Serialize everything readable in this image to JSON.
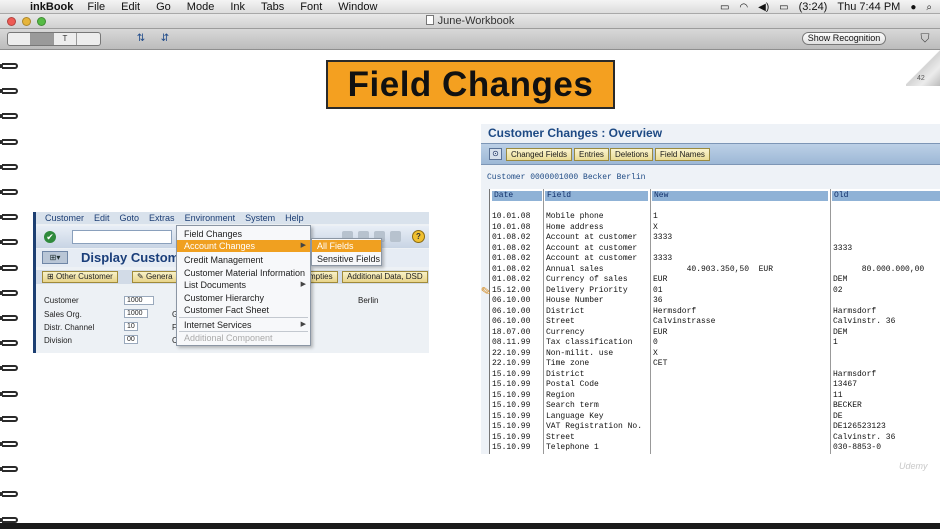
{
  "menubar": {
    "app_name": "inkBook",
    "items": [
      "File",
      "Edit",
      "Go",
      "Mode",
      "Ink",
      "Tabs",
      "Font",
      "Window"
    ],
    "battery": "(3:24)",
    "clock": "Thu 7:44 PM"
  },
  "window": {
    "title": "June-Workbook"
  },
  "toolbar": {
    "tool_labels": [
      "",
      "",
      "T",
      ""
    ],
    "show_recognition": "Show Recognition"
  },
  "page": {
    "page_number": "42",
    "banner": "Field Changes"
  },
  "sap_left": {
    "menu": [
      "Customer",
      "Edit",
      "Goto",
      "Extras",
      "Environment",
      "System",
      "Help"
    ],
    "screen_title": "Display Custom",
    "appbar": [
      "Other Customer",
      "Genera",
      "mpties",
      "Additional Data, DSD"
    ],
    "fields": [
      {
        "label": "Customer",
        "value": "1000",
        "extra": "Berlin"
      },
      {
        "label": "Sales Org.",
        "value": "1000",
        "extra": "G"
      },
      {
        "label": "Distr. Channel",
        "value": "10",
        "extra": "Fi"
      },
      {
        "label": "Division",
        "value": "00",
        "extra": "C"
      }
    ]
  },
  "context_menu": {
    "items": [
      {
        "label": "Field Changes"
      },
      {
        "label": "Account Changes"
      },
      {
        "label": "Credit Management"
      },
      {
        "label": "Customer Material Information"
      },
      {
        "label": "List Documents"
      },
      {
        "label": "Customer Hierarchy"
      },
      {
        "label": "Customer Fact Sheet"
      },
      {
        "label": "Internet Services"
      },
      {
        "label": "Additional Component"
      }
    ],
    "submenu": [
      {
        "label": "All Fields"
      },
      {
        "label": "Sensitive Fields"
      }
    ]
  },
  "sap_right": {
    "title": "Customer Changes : Overview",
    "toolbar_buttons": [
      "Changed Fields",
      "Entries",
      "Deletions",
      "Field Names"
    ],
    "customer_line": "Customer 0000001000 Becker Berlin",
    "columns": [
      "Date",
      "Field",
      "New",
      "Old"
    ],
    "rows": [
      {
        "date": "10.01.08",
        "field": "Mobile phone",
        "new": "1",
        "old": ""
      },
      {
        "date": "10.01.08",
        "field": "Home address",
        "new": "X",
        "old": ""
      },
      {
        "date": "01.08.02",
        "field": "Account at customer",
        "new": "3333",
        "old": ""
      },
      {
        "date": "01.08.02",
        "field": "Account at customer",
        "new": "",
        "old": "3333"
      },
      {
        "date": "01.08.02",
        "field": "Account at customer",
        "new": "3333",
        "old": ""
      },
      {
        "date": "01.08.02",
        "field": "Annual sales",
        "new": "       40.903.350,50  EUR",
        "old": "      80.000.000,00"
      },
      {
        "date": "01.08.02",
        "field": "Currency of sales",
        "new": "EUR",
        "old": "DEM"
      },
      {
        "date": "15.12.00",
        "field": "Delivery Priority",
        "new": "01",
        "old": "02"
      },
      {
        "date": "06.10.00",
        "field": "House Number",
        "new": "36",
        "old": ""
      },
      {
        "date": "06.10.00",
        "field": "District",
        "new": "Hermsdorf",
        "old": "Harmsdorf"
      },
      {
        "date": "06.10.00",
        "field": "Street",
        "new": "Calvinstrasse",
        "old": "Calvinstr. 36"
      },
      {
        "date": "18.07.00",
        "field": "Currency",
        "new": "EUR",
        "old": "DEM"
      },
      {
        "date": "08.11.99",
        "field": "Tax classification",
        "new": "0",
        "old": "1"
      },
      {
        "date": "22.10.99",
        "field": "Non-milit. use",
        "new": "X",
        "old": ""
      },
      {
        "date": "22.10.99",
        "field": "Time zone",
        "new": "CET",
        "old": ""
      },
      {
        "date": "15.10.99",
        "field": "District",
        "new": "",
        "old": "Harmsdorf"
      },
      {
        "date": "15.10.99",
        "field": "Postal Code",
        "new": "",
        "old": "13467"
      },
      {
        "date": "15.10.99",
        "field": "Region",
        "new": "",
        "old": "11"
      },
      {
        "date": "15.10.99",
        "field": "Search term",
        "new": "",
        "old": "BECKER"
      },
      {
        "date": "15.10.99",
        "field": "Language Key",
        "new": "",
        "old": "DE"
      },
      {
        "date": "15.10.99",
        "field": "VAT Registration No.",
        "new": "",
        "old": "DE126523123"
      },
      {
        "date": "15.10.99",
        "field": "Street",
        "new": "",
        "old": "Calvinstr. 36"
      },
      {
        "date": "15.10.99",
        "field": "Telephone 1",
        "new": "",
        "old": "030-8853-0"
      }
    ]
  },
  "watermark": "Udemy",
  "colors": {
    "banner": "#f4a020",
    "menu_highlight": "#f0a020",
    "sap_title_blue": "#1e4a84",
    "column_header": "#8fb2d6"
  }
}
